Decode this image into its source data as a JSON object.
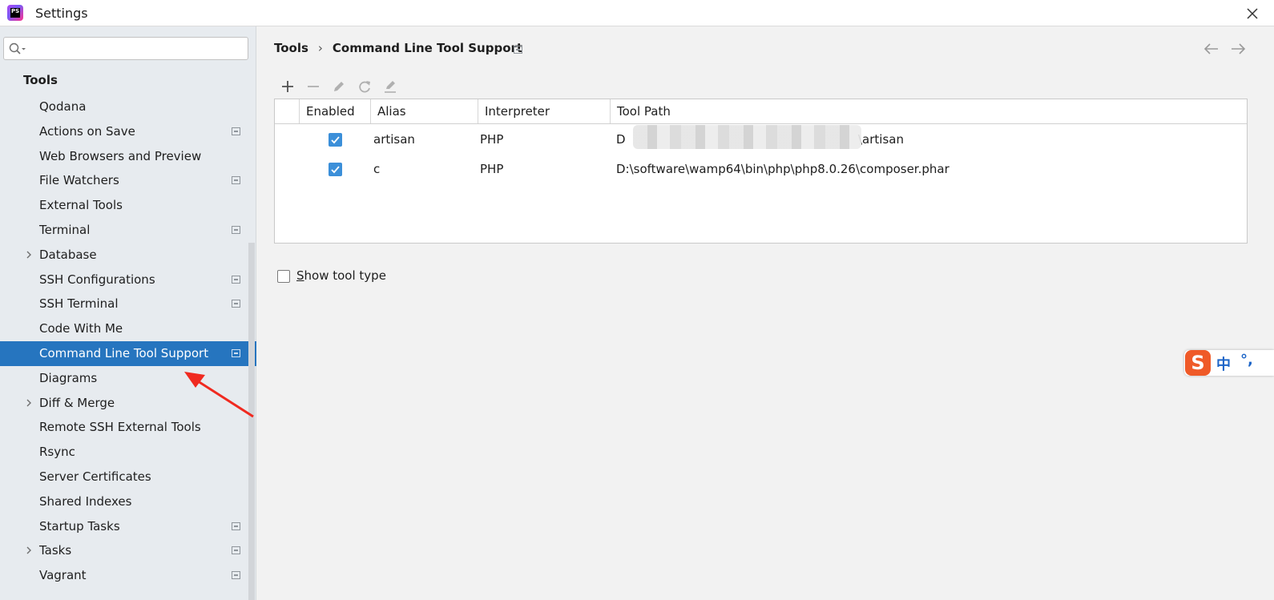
{
  "window": {
    "title": "Settings"
  },
  "search": {
    "placeholder": "",
    "value": ""
  },
  "sidebar": {
    "root_label": "Tools",
    "items": [
      {
        "label": "Qodana",
        "chevron": false,
        "project_icon": false,
        "selected": false
      },
      {
        "label": "Actions on Save",
        "chevron": false,
        "project_icon": true,
        "selected": false
      },
      {
        "label": "Web Browsers and Preview",
        "chevron": false,
        "project_icon": false,
        "selected": false
      },
      {
        "label": "File Watchers",
        "chevron": false,
        "project_icon": true,
        "selected": false
      },
      {
        "label": "External Tools",
        "chevron": false,
        "project_icon": false,
        "selected": false
      },
      {
        "label": "Terminal",
        "chevron": false,
        "project_icon": true,
        "selected": false
      },
      {
        "label": "Database",
        "chevron": true,
        "project_icon": false,
        "selected": false
      },
      {
        "label": "SSH Configurations",
        "chevron": false,
        "project_icon": true,
        "selected": false
      },
      {
        "label": "SSH Terminal",
        "chevron": false,
        "project_icon": true,
        "selected": false
      },
      {
        "label": "Code With Me",
        "chevron": false,
        "project_icon": false,
        "selected": false
      },
      {
        "label": "Command Line Tool Support",
        "chevron": false,
        "project_icon": true,
        "selected": true
      },
      {
        "label": "Diagrams",
        "chevron": false,
        "project_icon": false,
        "selected": false
      },
      {
        "label": "Diff & Merge",
        "chevron": true,
        "project_icon": false,
        "selected": false
      },
      {
        "label": "Remote SSH External Tools",
        "chevron": false,
        "project_icon": false,
        "selected": false
      },
      {
        "label": "Rsync",
        "chevron": false,
        "project_icon": false,
        "selected": false
      },
      {
        "label": "Server Certificates",
        "chevron": false,
        "project_icon": false,
        "selected": false
      },
      {
        "label": "Shared Indexes",
        "chevron": false,
        "project_icon": false,
        "selected": false
      },
      {
        "label": "Startup Tasks",
        "chevron": false,
        "project_icon": true,
        "selected": false
      },
      {
        "label": "Tasks",
        "chevron": true,
        "project_icon": true,
        "selected": false
      },
      {
        "label": "Vagrant",
        "chevron": false,
        "project_icon": true,
        "selected": false
      }
    ]
  },
  "breadcrumb": {
    "parent": "Tools",
    "separator": "›",
    "current": "Command Line Tool Support"
  },
  "toolbar": {
    "icons": [
      "add-icon",
      "remove-icon",
      "edit-icon",
      "refresh-icon",
      "edit-definition-icon"
    ]
  },
  "table": {
    "headers": {
      "enabled": "Enabled",
      "alias": "Alias",
      "interpreter": "Interpreter",
      "tool_path": "Tool Path"
    },
    "rows": [
      {
        "enabled": true,
        "alias": "artisan",
        "interpreter": "PHP",
        "path_start": "D",
        "path_end": "\\artisan"
      },
      {
        "enabled": true,
        "alias": "c",
        "interpreter": "PHP",
        "path_start": "D:\\software\\wamp64\\bin\\php\\php8.0.26\\composer.phar",
        "path_end": ""
      }
    ]
  },
  "options": {
    "show_tool_type_mnemonic": "S",
    "show_tool_type_rest": "how tool type",
    "show_tool_type_checked": false
  },
  "ime": {
    "logo": "S",
    "mode": "中",
    "punct": "°,"
  },
  "colors": {
    "selection": "#2675bf",
    "checkbox": "#3b8fd9",
    "annotation_arrow": "#f02a20",
    "ime_logo": "#ef5a28"
  }
}
